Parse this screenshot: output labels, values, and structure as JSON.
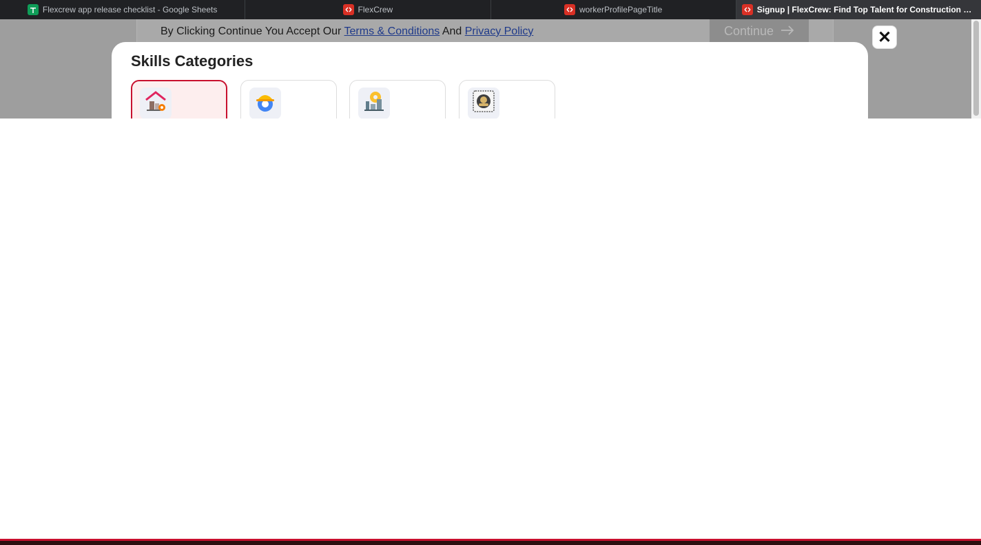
{
  "tabs": [
    {
      "title": "Flexcrew app release checklist - Google Sheets",
      "favicon": "sheets-icon",
      "active": false
    },
    {
      "title": "FlexCrew",
      "favicon": "flexcrew-icon",
      "active": false
    },
    {
      "title": "workerProfilePageTitle",
      "favicon": "flexcrew-icon",
      "active": false
    },
    {
      "title": "Signup | FlexCrew: Find Top Talent for Construction Jobs",
      "favicon": "flexcrew-icon",
      "active": true
    }
  ],
  "consent": {
    "prefix": "By Clicking Continue You Accept Our",
    "terms_link": "Terms & Conditions",
    "and": "And",
    "privacy_link": "Privacy Policy"
  },
  "continue_button": {
    "label": "Continue",
    "icon": "arrow-right-icon"
  },
  "modal": {
    "title": "Skills Categories",
    "close_label": "✕",
    "categories": [
      {
        "icon": "home-gear-icon",
        "selected": true
      },
      {
        "icon": "worker-helmet-gear-icon",
        "selected": false
      },
      {
        "icon": "factory-gear-icon",
        "selected": false
      },
      {
        "icon": "badge-emblem-icon",
        "selected": false
      }
    ]
  },
  "colors": {
    "accent": "#c8102e",
    "selected_bg": "#fdeeee",
    "link": "#1f3a8a"
  }
}
